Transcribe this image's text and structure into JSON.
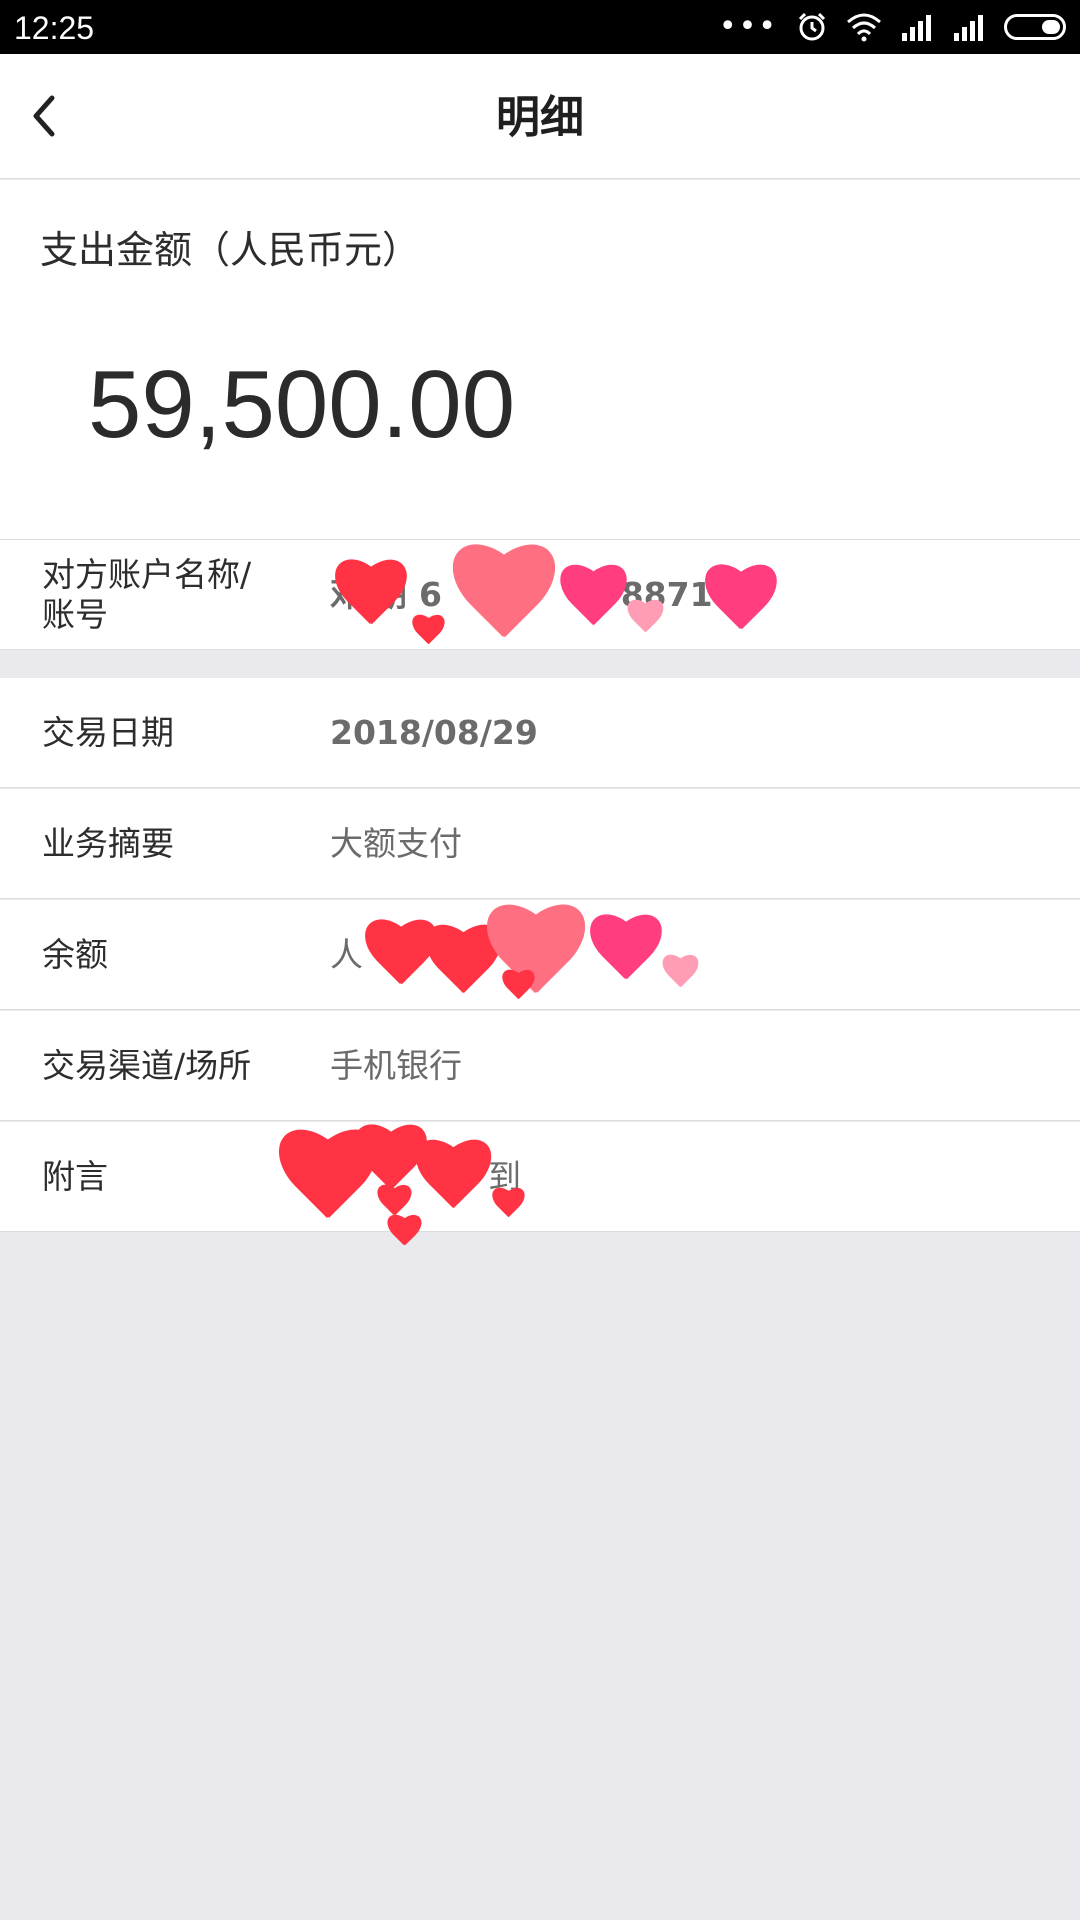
{
  "status_bar": {
    "time": "12:25",
    "dots": "•••"
  },
  "header": {
    "title": "明细",
    "back_icon": "chevron-left-icon"
  },
  "amount": {
    "label": "支出金额（人民币元）",
    "value": "59,500.00"
  },
  "details": {
    "counterparty_label": "对方账户名称/账号",
    "counterparty_value": "邓 朋 6",
    "counterparty_suffix": "* 8871",
    "date_label": "交易日期",
    "date_value": "2018/08/29",
    "summary_label": "业务摘要",
    "summary_value": "大额支付",
    "balance_label": "余额",
    "balance_value": "人",
    "channel_label": "交易渠道/场所",
    "channel_value": "手机银行",
    "note_label": "附言",
    "note_value": "到"
  },
  "colors": {
    "heart_red": "#ff3344",
    "heart_pink": "#ff6f82",
    "heart_magenta": "#ff3d7f",
    "heart_light": "#ff9db5"
  }
}
